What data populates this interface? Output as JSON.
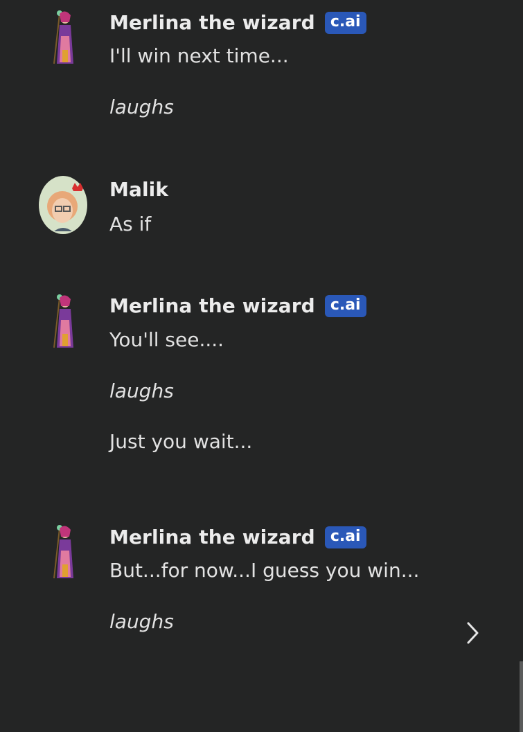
{
  "messages": [
    {
      "name": "Merlina the wizard",
      "badge": "c.ai",
      "lines": [
        "I'll win next time...",
        "laughs"
      ]
    },
    {
      "name": "Malik",
      "lines": [
        "As if"
      ]
    },
    {
      "name": "Merlina the wizard",
      "badge": "c.ai",
      "lines": [
        "You'll see....",
        "laughs",
        "Just you wait..."
      ]
    },
    {
      "name": "Merlina the wizard",
      "badge": "c.ai",
      "lines": [
        "But...for now...I guess you win...",
        "laughs"
      ]
    }
  ],
  "icons": {
    "wizard_avatar": "wizard-avatar-icon",
    "user_avatar": "user-avatar-icon",
    "next": "chevron-right-icon"
  },
  "colors": {
    "background": "#242525",
    "badge": "#2a58b8",
    "text": "#e6e6e6"
  }
}
